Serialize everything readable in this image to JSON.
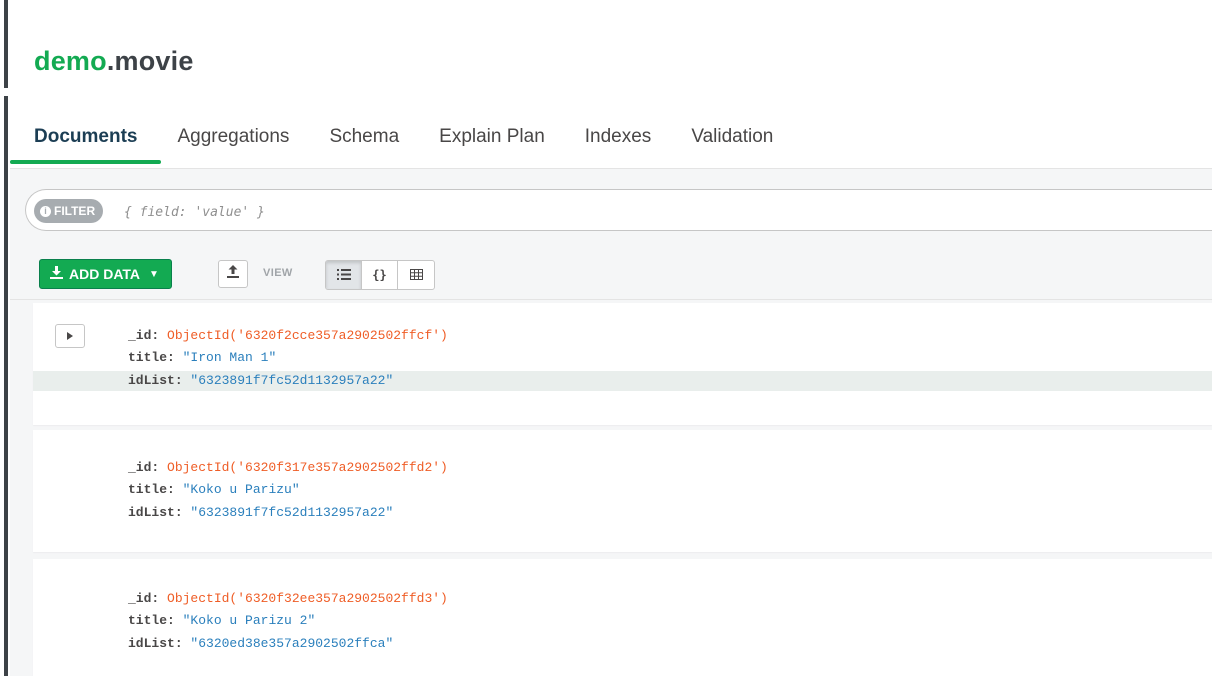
{
  "namespace": {
    "database": "demo",
    "collection": ".movie"
  },
  "tabs": [
    {
      "label": "Documents",
      "active": true
    },
    {
      "label": "Aggregations",
      "active": false
    },
    {
      "label": "Schema",
      "active": false
    },
    {
      "label": "Explain Plan",
      "active": false
    },
    {
      "label": "Indexes",
      "active": false
    },
    {
      "label": "Validation",
      "active": false
    }
  ],
  "filter": {
    "badge_label": "FILTER",
    "placeholder": "{ field: 'value' }",
    "value": ""
  },
  "toolbar": {
    "add_data_label": "ADD DATA",
    "view_label": "VIEW",
    "view_modes": [
      "list-view",
      "json-view",
      "table-view"
    ],
    "active_view": "list-view"
  },
  "documents": [
    {
      "id_key": "_id",
      "id_value": "ObjectId('6320f2cce357a2902502ffcf')",
      "title_key": "title",
      "title_value": "\"Iron Man 1\"",
      "idlist_key": "idList",
      "idlist_value": "\"6323891f7fc52d1132957a22\""
    },
    {
      "id_key": "_id",
      "id_value": "ObjectId('6320f317e357a2902502ffd2')",
      "title_key": "title",
      "title_value": "\"Koko u Parizu\"",
      "idlist_key": "idList",
      "idlist_value": "\"6323891f7fc52d1132957a22\""
    },
    {
      "id_key": "_id",
      "id_value": "ObjectId('6320f32ee357a2902502ffd3')",
      "title_key": "title",
      "title_value": "\"Koko u Parizu 2\"",
      "idlist_key": "idList",
      "idlist_value": "\"6320ed38e357a2902502ffca\""
    }
  ],
  "colors": {
    "accent_green": "#13aa52",
    "object_id": "#ef5d26",
    "string_value": "#2a7fbc",
    "field_key": "#494747"
  }
}
